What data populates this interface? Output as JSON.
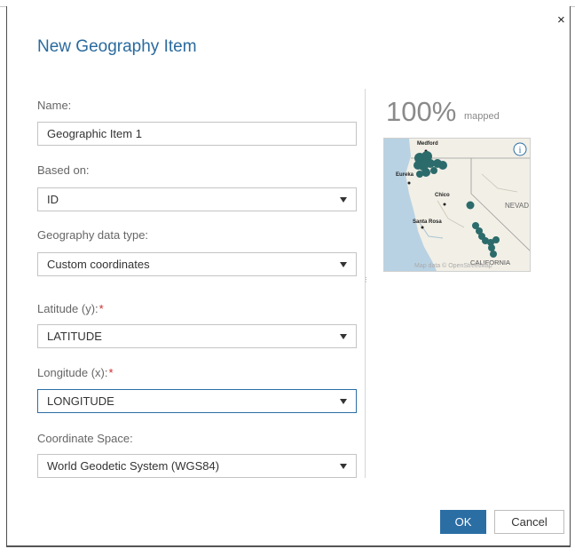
{
  "dialog": {
    "title": "New Geography Item",
    "close_glyph": "×"
  },
  "form": {
    "name": {
      "label": "Name:",
      "value": "Geographic Item 1"
    },
    "based_on": {
      "label": "Based on:",
      "value": "ID"
    },
    "geo_type": {
      "label": "Geography data type:",
      "value": "Custom coordinates"
    },
    "latitude": {
      "label": "Latitude (y):",
      "required_mark": "*",
      "value": "LATITUDE"
    },
    "longitude": {
      "label": "Longitude (x):",
      "required_mark": "*",
      "value": "LONGITUDE"
    },
    "coord_space": {
      "label": "Coordinate Space:",
      "value": "World Geodetic System (WGS84)"
    }
  },
  "preview": {
    "percent": "100%",
    "percent_label": "mapped",
    "map": {
      "cities": [
        "Medford",
        "Eureka",
        "Chico",
        "Santa Rosa"
      ],
      "regions": [
        "NEVAD",
        "CALIFORNIA"
      ],
      "attribution": "Map data © OpenStreetMap",
      "info_icon": "info-icon",
      "marker_color": "#2c6b6b"
    }
  },
  "buttons": {
    "ok": "OK",
    "cancel": "Cancel"
  },
  "colors": {
    "accent": "#2b6ea4",
    "title": "#2a6a9e",
    "required": "#d02b2b"
  }
}
